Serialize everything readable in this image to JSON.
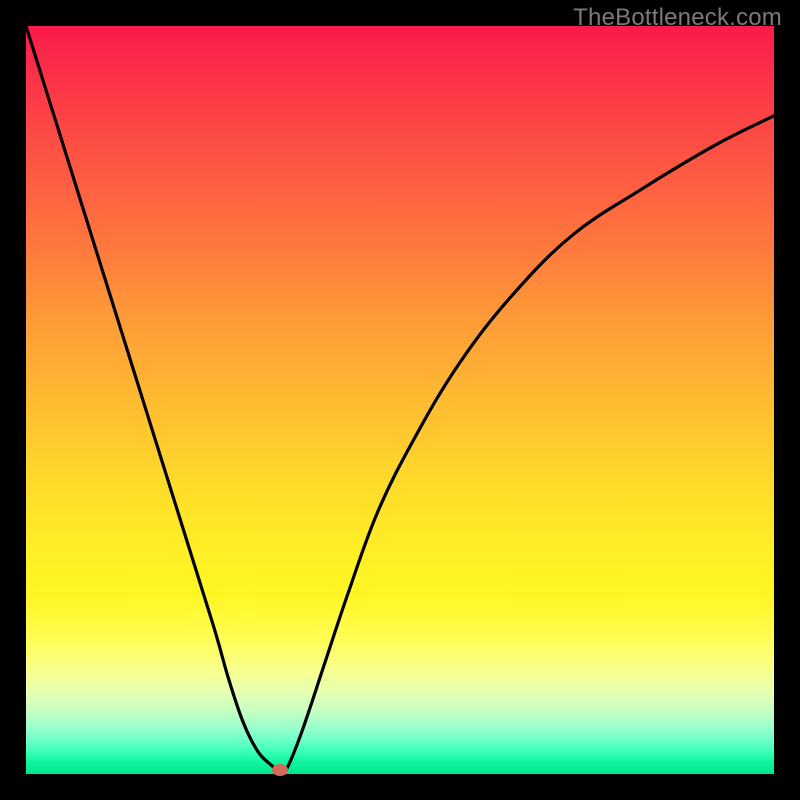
{
  "watermark": "TheBottleneck.com",
  "chart_data": {
    "type": "line",
    "title": "",
    "xlabel": "",
    "ylabel": "",
    "xlim": [
      0,
      100
    ],
    "ylim": [
      0,
      100
    ],
    "background_gradient": {
      "top_color": "#fb1a4a",
      "bottom_color": "#00e58a",
      "description": "vertical red-to-green gradient"
    },
    "series": [
      {
        "name": "bottleneck-curve",
        "color": "#000000",
        "x": [
          0,
          5,
          10,
          15,
          20,
          25,
          27,
          29,
          31,
          33,
          34,
          35,
          37,
          40,
          43,
          47,
          52,
          58,
          65,
          73,
          82,
          92,
          100
        ],
        "values": [
          100,
          84,
          68,
          52,
          36,
          20,
          13,
          7,
          3,
          1,
          0,
          1,
          6,
          15,
          24,
          35,
          45,
          55,
          64,
          72,
          78,
          84,
          88
        ]
      }
    ],
    "marker": {
      "x": 34,
      "y": 0,
      "color": "#d36a5c"
    },
    "grid": false,
    "legend": false
  },
  "plot": {
    "inner_left": 26,
    "inner_top": 26,
    "inner_width": 748,
    "inner_height": 748
  }
}
